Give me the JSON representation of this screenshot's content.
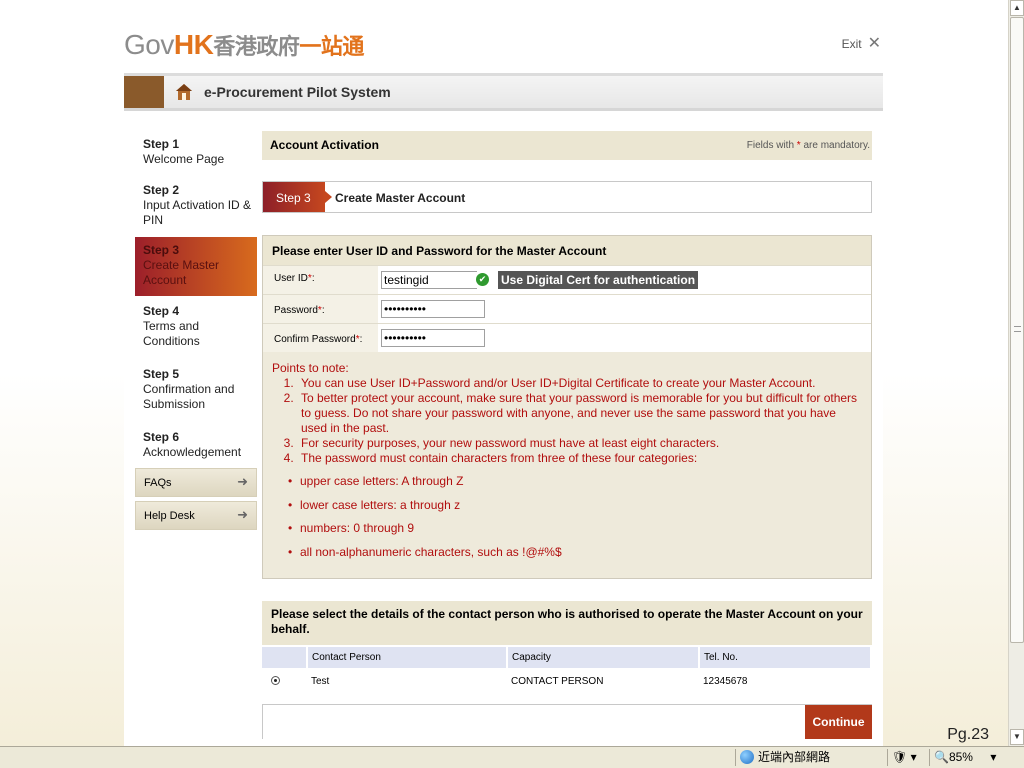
{
  "header": {
    "logo_gov": "Gov",
    "logo_hk": "HK",
    "logo_cn": "香港政府",
    "logo_cn2": "一站通",
    "exit_label": "Exit",
    "system_title": "e-Procurement Pilot System"
  },
  "sidebar": {
    "steps": [
      {
        "num": "Step 1",
        "label": "Welcome Page"
      },
      {
        "num": "Step 2",
        "label": "Input Activation ID & PIN"
      },
      {
        "num": "Step 3",
        "label": "Create Master Account"
      },
      {
        "num": "Step 4",
        "label": "Terms and Conditions"
      },
      {
        "num": "Step 5",
        "label": "Confirmation and Submission"
      },
      {
        "num": "Step 6",
        "label": "Acknowledgement"
      }
    ],
    "faqs": "FAQs",
    "helpdesk": "Help Desk"
  },
  "main": {
    "section_title": "Account Activation",
    "mandatory_pre": "Fields with",
    "mandatory_star": "*",
    "mandatory_post": "are mandatory.",
    "step_tag": "Step 3",
    "step_label": "Create Master Account",
    "form_title": "Please enter User ID and Password for the Master Account",
    "userid_label": "User ID",
    "userid_value": "testingid",
    "cert_button": "Use Digital Cert for authentication",
    "password_label": "Password",
    "password_value": "••••••••••",
    "confirm_label": "Confirm Password",
    "confirm_value": "••••••••••",
    "notes_title": "Points to note:",
    "notes": [
      "You can use User ID+Password and/or User ID+Digital Certificate to create your Master Account.",
      "To better protect your account, make sure that your password is memorable for you but difficult for others to guess. Do not share your password with anyone, and never use the same password that you have used in the past.",
      "For security purposes, your new password must have at least eight characters.",
      "The password must contain characters from three of these four categories:"
    ],
    "categories": [
      "upper case letters: A through Z",
      "lower case letters: a through z",
      "numbers: 0 through 9",
      "all non-alphanumeric characters, such as !@#%$"
    ],
    "contact_title": "Please select the details of the contact person who is authorised to operate the Master Account on your behalf.",
    "contact_columns": [
      "Contact Person",
      "Capacity",
      "Tel. No."
    ],
    "contact_rows": [
      {
        "person": "Test",
        "capacity": "CONTACT PERSON",
        "tel": "12345678"
      }
    ],
    "continue_label": "Continue"
  },
  "page_label": "Pg.23",
  "statusbar": {
    "zone": "近端內部網路",
    "zoom": "85%"
  }
}
